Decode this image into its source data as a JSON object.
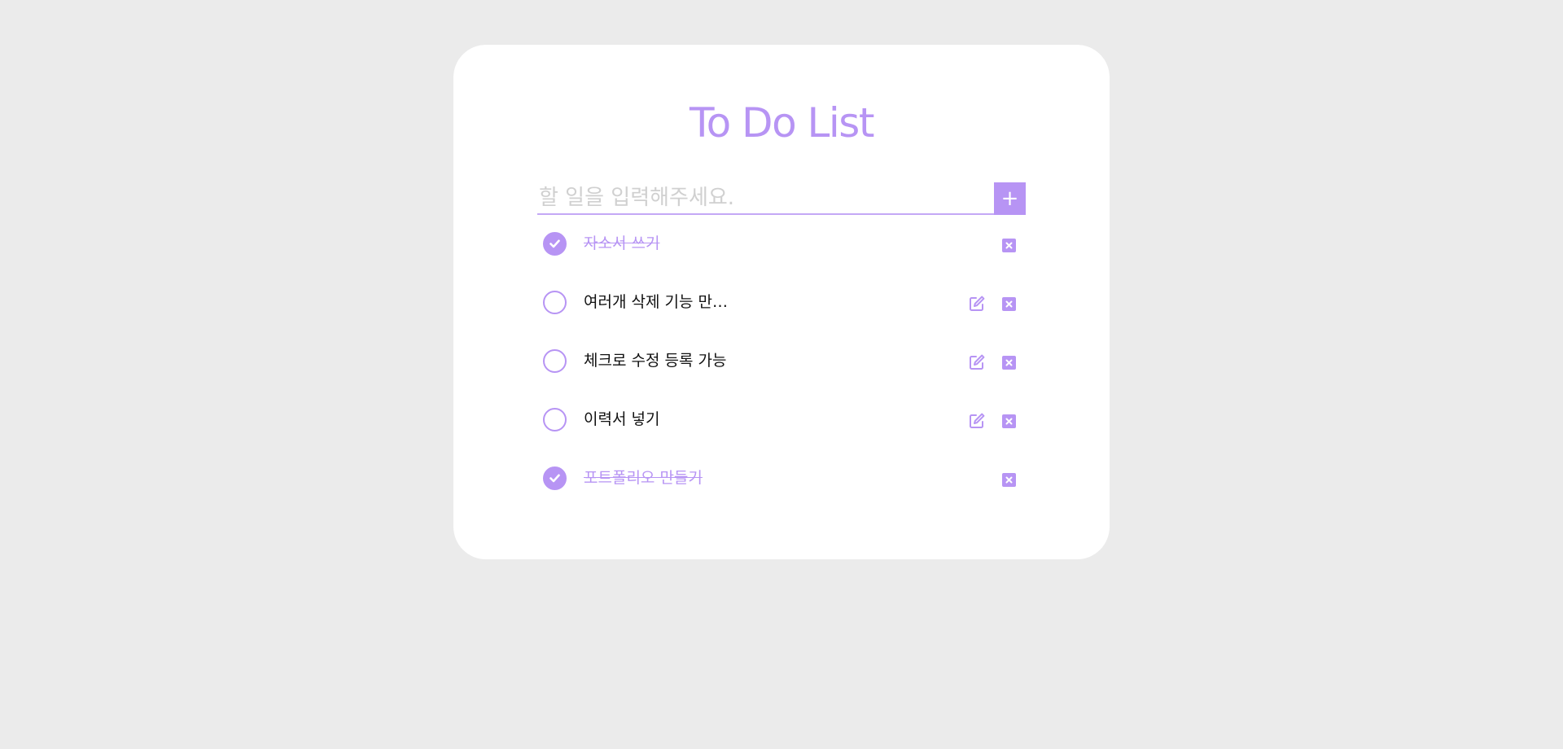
{
  "app": {
    "title": "To Do List",
    "accent_color": "#b794f4"
  },
  "input": {
    "placeholder": "할 일을 입력해주세요.",
    "value": "",
    "add_label": "+"
  },
  "todos": [
    {
      "text": "자소서 쓰기",
      "completed": true,
      "editable": false
    },
    {
      "text": "여러개 삭제 기능 만…",
      "completed": false,
      "editable": true
    },
    {
      "text": "체크로 수정 등록 가능",
      "completed": false,
      "editable": true
    },
    {
      "text": "이력서 넣기",
      "completed": false,
      "editable": true
    },
    {
      "text": "포트폴리오 만들기",
      "completed": true,
      "editable": false
    }
  ],
  "icons": {
    "check": "check-circle-icon",
    "edit": "edit-icon",
    "delete": "delete-icon",
    "add": "plus-icon"
  }
}
